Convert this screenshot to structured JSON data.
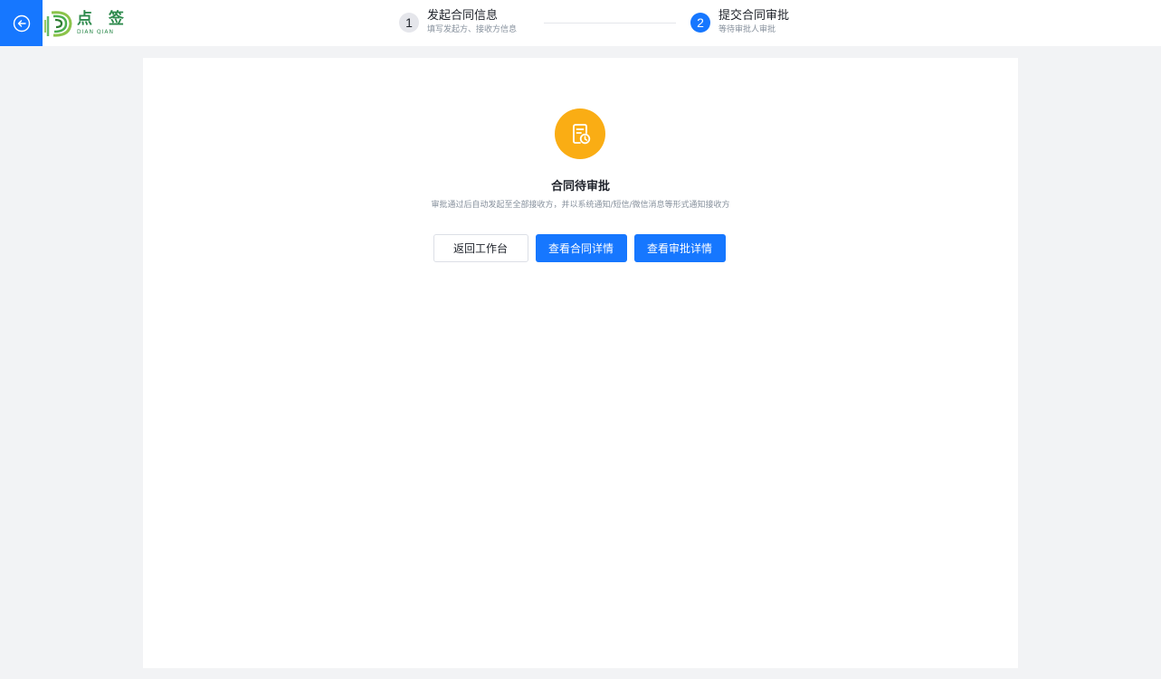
{
  "header": {
    "logo": {
      "name_cn": "点 签",
      "name_en": "DIAN QIAN"
    },
    "steps": [
      {
        "number": "1",
        "title": "发起合同信息",
        "desc": "填写发起方、接收方信息"
      },
      {
        "number": "2",
        "title": "提交合同审批",
        "desc": "等待审批人审批"
      }
    ],
    "active_step": 2
  },
  "result": {
    "icon": "contract-pending-icon",
    "title": "合同待审批",
    "description": "审批通过后自动发起至全部接收方，并以系统通知/短信/微信消息等形式通知接收方"
  },
  "actions": {
    "back_label": "返回工作台",
    "contract_detail_label": "查看合同详情",
    "approval_detail_label": "查看审批详情"
  },
  "colors": {
    "primary": "#1677ff",
    "warning": "#faad14",
    "brand_green": "#2e8a4d"
  }
}
